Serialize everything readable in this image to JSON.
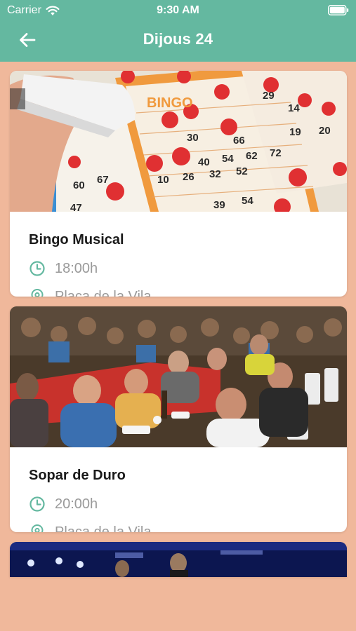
{
  "status_bar": {
    "carrier": "Carrier",
    "time": "9:30 AM"
  },
  "header": {
    "title": "Dijous 24",
    "back_icon": "arrow-left-icon",
    "background_color": "#64b8a0"
  },
  "events": [
    {
      "title": "Bingo Musical",
      "time": "18:00h",
      "place": "Plaça de la Vila",
      "image_subject": "bingo cards with red marker"
    },
    {
      "title": "Sopar de Duro",
      "time": "20:00h",
      "place": "Plaça de la Vila",
      "image_subject": "crowd dining at long outdoor tables"
    }
  ],
  "colors": {
    "accent": "#64b8a0",
    "page_background": "#f0b89b",
    "meta_text": "#9a9a9a"
  }
}
